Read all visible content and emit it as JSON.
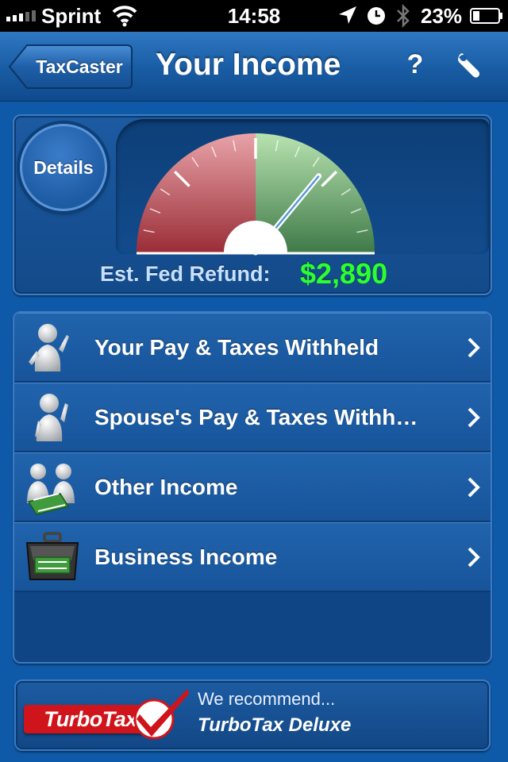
{
  "status_bar": {
    "carrier": "Sprint",
    "time": "14:58",
    "battery": "23%",
    "icons": [
      "signal-icon",
      "wifi-icon",
      "location-icon",
      "clock-icon",
      "bluetooth-icon",
      "battery-icon"
    ]
  },
  "nav": {
    "back_label": "TaxCaster",
    "title": "Your Income",
    "help_label": "?",
    "settings_icon": "wrench-icon"
  },
  "refund": {
    "details_label": "Details",
    "label": "Est. Fed Refund:",
    "amount": "$2,890",
    "amount_color": "#2dff2d",
    "gauge_level": 0.72,
    "gauge_colors": {
      "negative": "#b84a52",
      "positive": "#6aa56a"
    }
  },
  "menu": {
    "items": [
      {
        "label": "Your Pay & Taxes Withheld",
        "icon": "person-icon"
      },
      {
        "label": "Spouse's Pay & Taxes Withh…",
        "icon": "person-icon"
      },
      {
        "label": "Other Income",
        "icon": "people-money-icon"
      },
      {
        "label": "Business Income",
        "icon": "briefcase-money-icon"
      }
    ]
  },
  "recommendation": {
    "logo_text": "TurboTax",
    "label": "We recommend...",
    "product": "TurboTax Deluxe"
  },
  "colors": {
    "background": "#0f5aa8",
    "nav": "#1a5ea6",
    "logo_red": "#d0141b"
  }
}
